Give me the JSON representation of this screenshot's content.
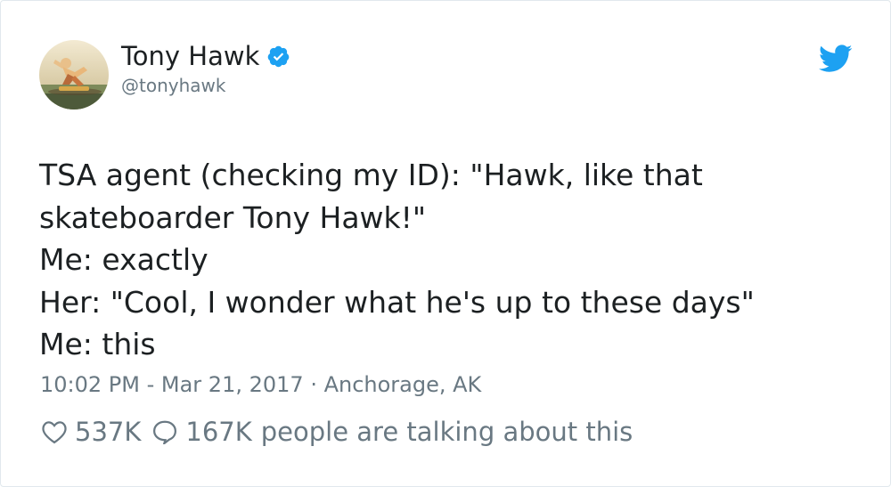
{
  "tweet": {
    "author": {
      "display_name": "Tony Hawk",
      "handle": "@tonyhawk",
      "verified": true
    },
    "text_lines": [
      "TSA agent (checking my ID): \"Hawk, like that",
      "skateboarder Tony Hawk!\"",
      "Me: exactly",
      "Her: \"Cool, I wonder what he's up to these days\"",
      "Me: this"
    ],
    "time": "10:02 PM - Mar 21, 2017",
    "separator": " · ",
    "location": "Anchorage, AK",
    "likes": "537K",
    "talking_count": "167K",
    "talking_label": "people are talking about this"
  },
  "colors": {
    "text": "#1c2022",
    "muted": "#697882",
    "twitter_blue": "#1da1f2",
    "border": "#e1e8ed"
  },
  "icons": {
    "verified": "verified-badge-icon",
    "brand": "twitter-bird-icon",
    "like": "heart-icon",
    "reply": "speech-bubble-icon"
  }
}
